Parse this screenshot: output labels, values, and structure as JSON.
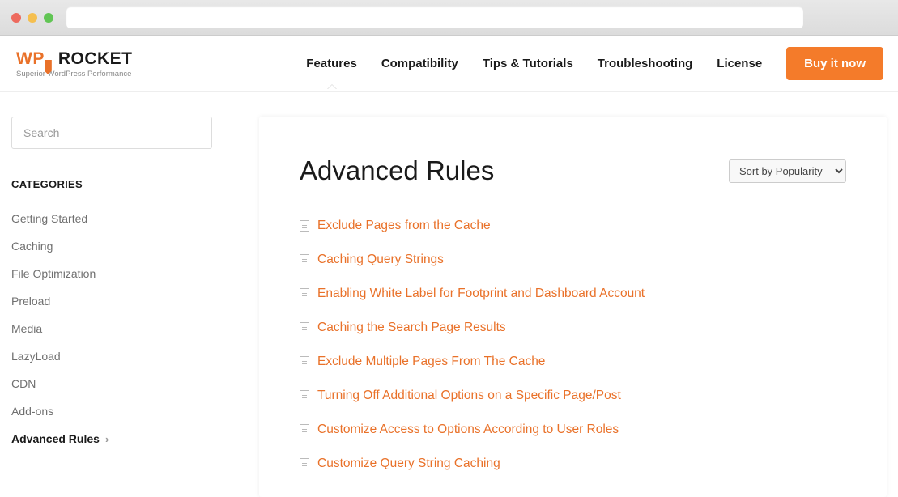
{
  "logo": {
    "wp": "WP",
    "rocket": "ROCKET",
    "tagline": "Superior WordPress Performance"
  },
  "nav": {
    "items": [
      {
        "label": "Features",
        "active": true
      },
      {
        "label": "Compatibility"
      },
      {
        "label": "Tips & Tutorials"
      },
      {
        "label": "Troubleshooting"
      },
      {
        "label": "License"
      }
    ],
    "cta": "Buy it now"
  },
  "sidebar": {
    "search_placeholder": "Search",
    "categories_heading": "CATEGORIES",
    "items": [
      {
        "label": "Getting Started"
      },
      {
        "label": "Caching"
      },
      {
        "label": "File Optimization"
      },
      {
        "label": "Preload"
      },
      {
        "label": "Media"
      },
      {
        "label": "LazyLoad"
      },
      {
        "label": "CDN"
      },
      {
        "label": "Add-ons"
      },
      {
        "label": "Advanced Rules",
        "active": true
      }
    ]
  },
  "main": {
    "title": "Advanced Rules",
    "sort": "Sort by Popularity",
    "articles": [
      "Exclude Pages from the Cache",
      "Caching Query Strings",
      "Enabling White Label for Footprint and Dashboard Account",
      "Caching the Search Page Results",
      "Exclude Multiple Pages From The Cache",
      "Turning Off Additional Options on a Specific Page/Post",
      "Customize Access to Options According to User Roles",
      "Customize Query String Caching"
    ]
  }
}
